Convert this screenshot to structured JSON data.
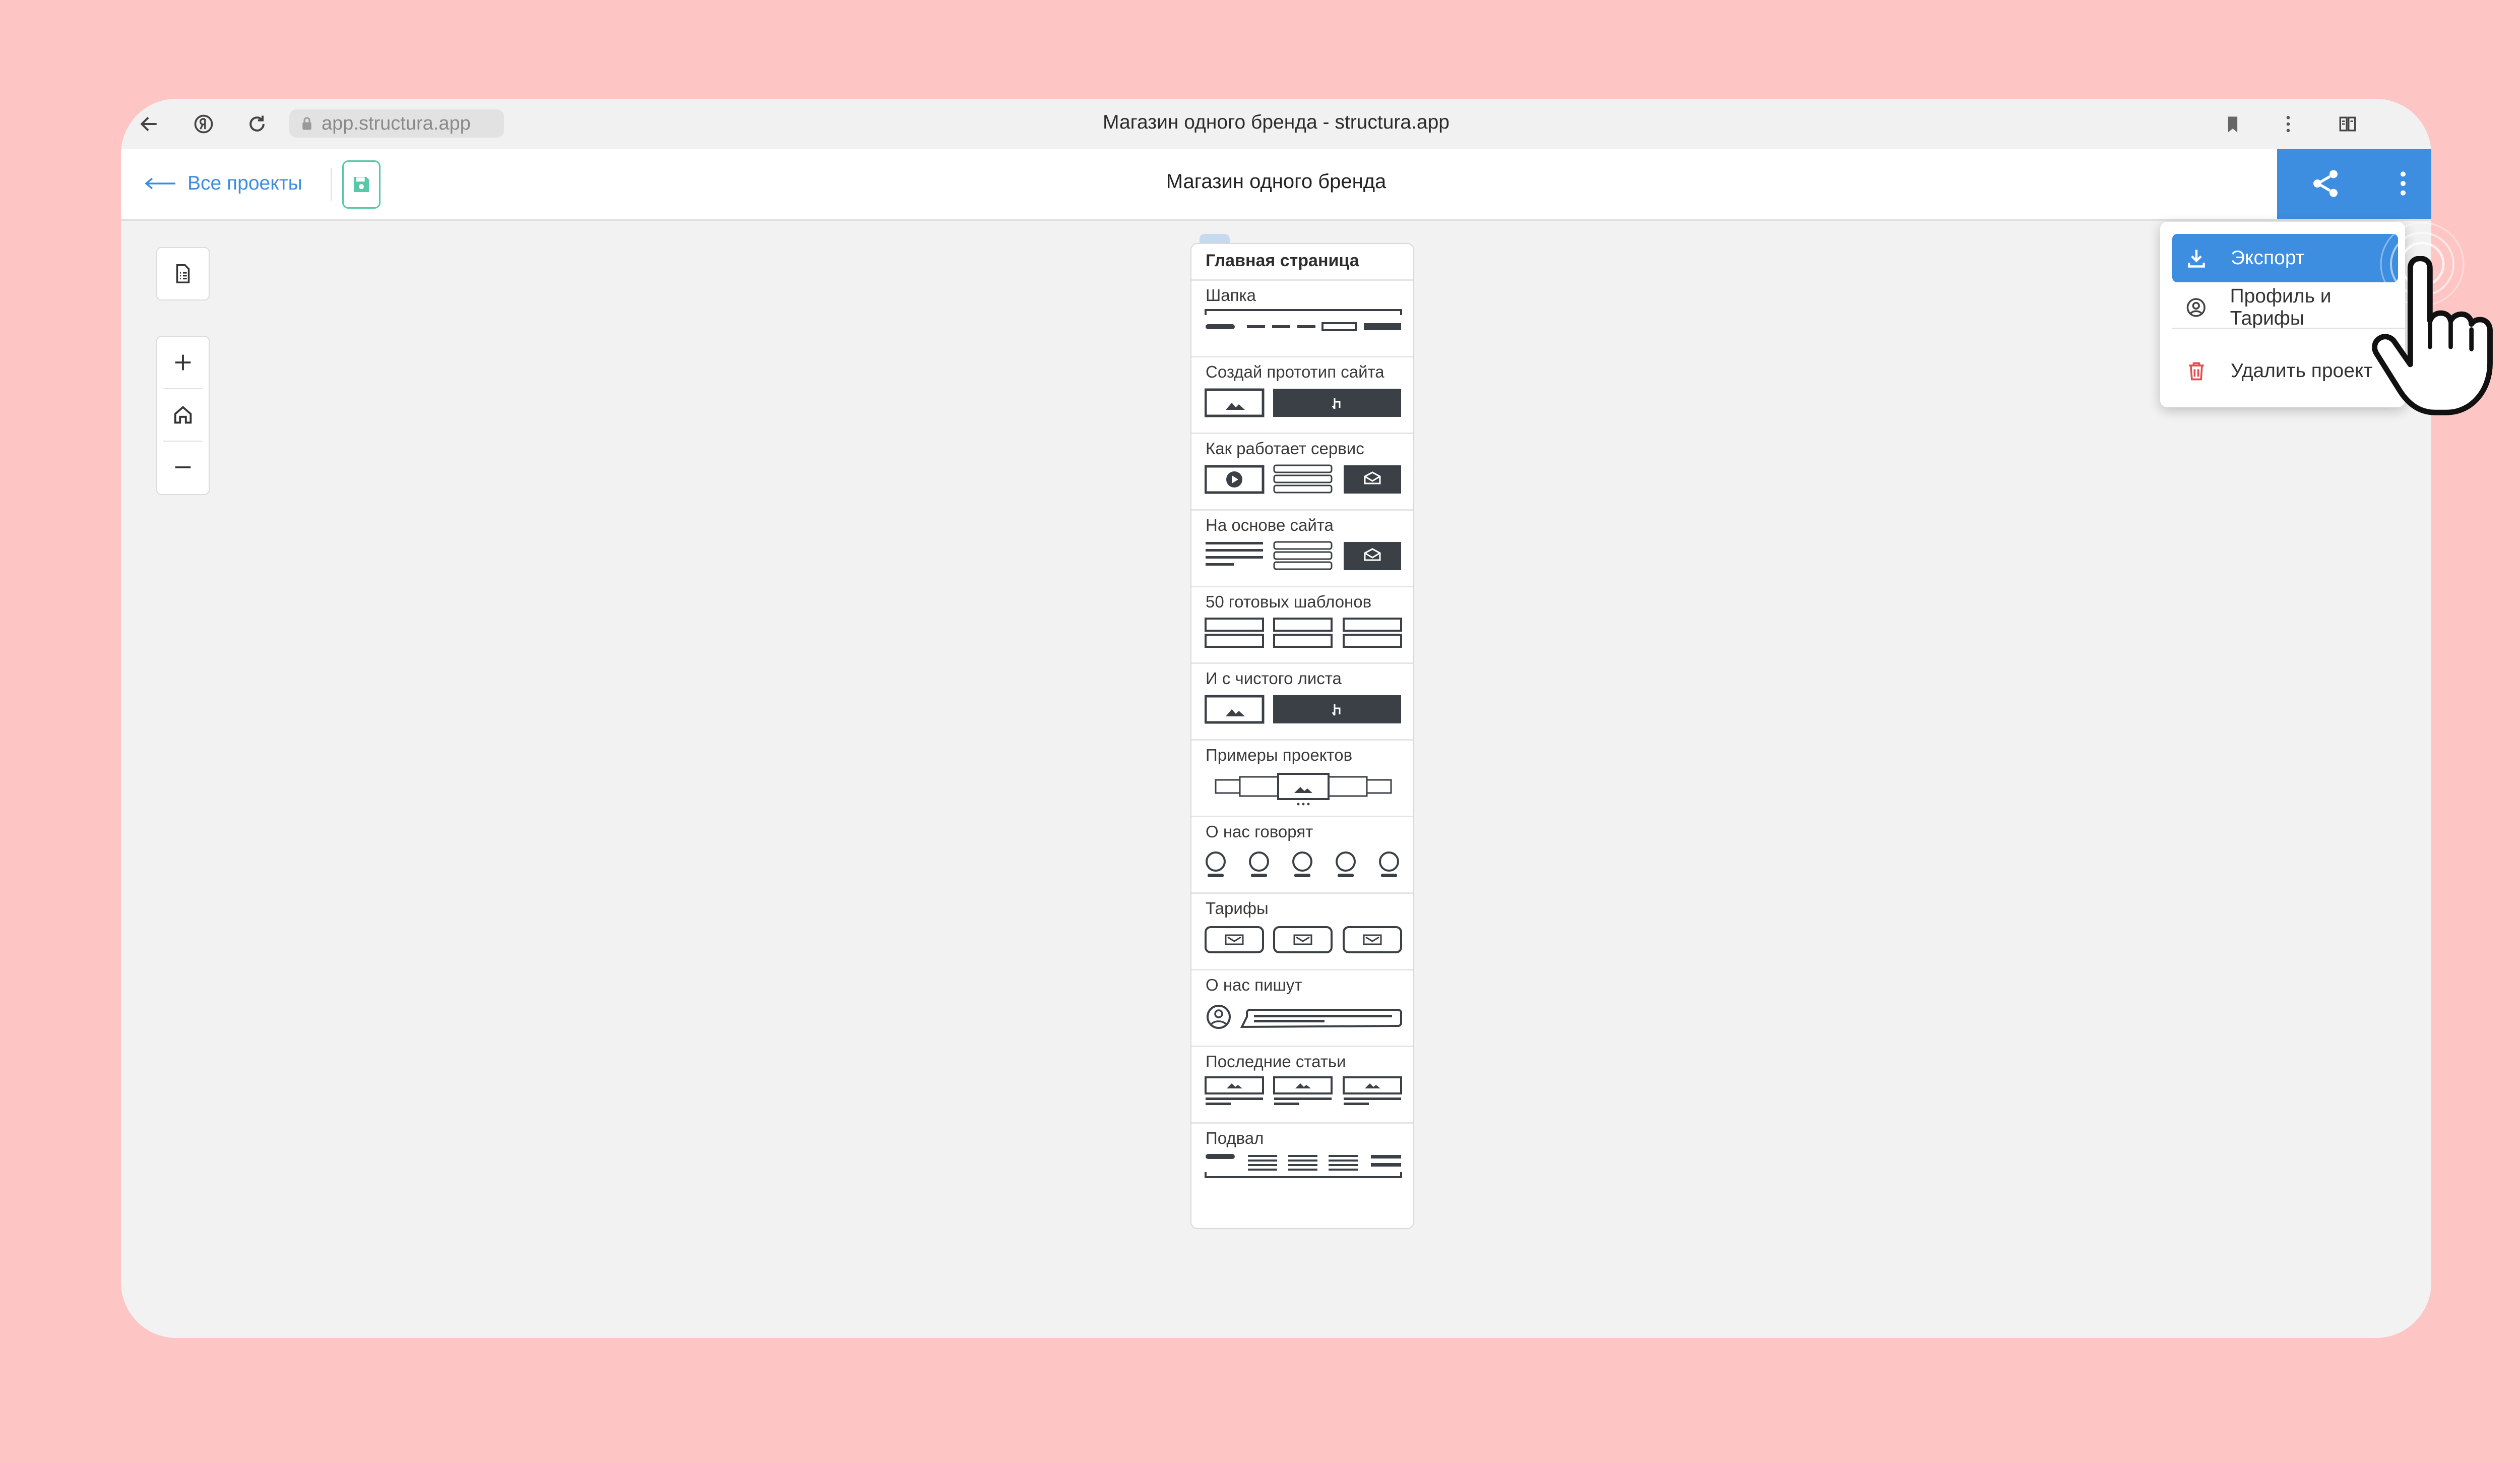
{
  "browser": {
    "url": "app.structura.app",
    "tab_title": "Магазин одного бренда - structura.app"
  },
  "header": {
    "back_label": "Все проекты",
    "project_title": "Магазин одного бренда"
  },
  "sitemap": {
    "page_title": "Главная страница",
    "blocks": [
      {
        "label": "Шапка"
      },
      {
        "label": "Создай прототип сайта"
      },
      {
        "label": "Как работает сервис"
      },
      {
        "label": "На основе сайта"
      },
      {
        "label": "50 готовых шаблонов"
      },
      {
        "label": "И с чистого листа"
      },
      {
        "label": "Примеры проектов"
      },
      {
        "label": "О нас говорят"
      },
      {
        "label": "Тарифы"
      },
      {
        "label": "О нас пишут"
      },
      {
        "label": "Последние статьи"
      },
      {
        "label": "Подвал"
      }
    ]
  },
  "menu": {
    "items": [
      {
        "label": "Экспорт",
        "icon": "download-icon",
        "active": true
      },
      {
        "label": "Профиль и Тарифы",
        "icon": "user-circle-icon",
        "active": false
      },
      {
        "label": "Удалить проект",
        "icon": "trash-icon",
        "active": false
      }
    ]
  },
  "colors": {
    "background": "#fec5c5",
    "accent": "#3d8de0",
    "save_accent": "#5ac8a8",
    "danger": "#e05050"
  }
}
